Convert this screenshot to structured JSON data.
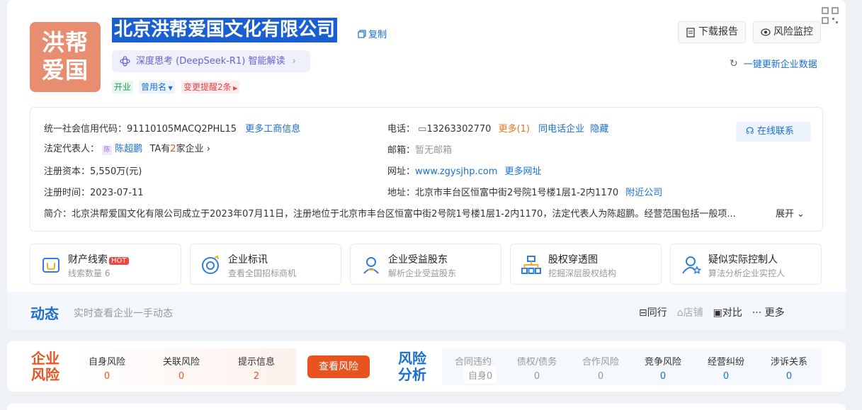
{
  "company": {
    "logo_text_line1": "洪帮",
    "logo_text_line2": "爱国",
    "name": "北京洪帮爱国文化有限公司",
    "copy_label": "复制",
    "ai_label": "深度思考 (DeepSeek-R1) 智能解读",
    "tags": {
      "status": "开业",
      "former_name": "曾用名",
      "change": "变更提醒2条"
    }
  },
  "actions": {
    "download": "下载报告",
    "monitor": "风险监控",
    "refresh": "一键更新企业数据",
    "online": "在线联系"
  },
  "info": {
    "credit_code_label": "统一社会信用代码：",
    "credit_code": "91110105MACQ2PHL15",
    "more_biz": "更多工商信息",
    "legal_label": "法定代表人：",
    "legal_icon": "陈",
    "legal_name": "陈超鹏",
    "legal_ta_prefix": "TA有",
    "legal_ta_count": "2",
    "legal_ta_suffix": "家企业",
    "capital_label": "注册资本：",
    "capital": "5,550万(元)",
    "date_label": "注册时间：",
    "date": "2023-07-11",
    "phone_label": "电话：",
    "phone": "13263302770",
    "phone_more": "更多(1)",
    "same_phone": "同电话企业",
    "hide": "隐藏",
    "email_label": "邮箱：",
    "email": "暂无邮箱",
    "site_label": "网址：",
    "site": "www.zgysjhp.com",
    "more_site": "更多网址",
    "addr_label": "地址：",
    "addr": "北京市丰台区恒富中街2号院1号楼1层1-2内1170",
    "nearby": "附近公司",
    "intro_label": "简介：",
    "intro": "北京洪帮爱国文化有限公司成立于2023年07月11日，注册地位于北京市丰台区恒富中街2号院1号楼1层1-2内1170，法定代表人为陈超鹏。经营范围包括一般项...",
    "expand": "展开"
  },
  "features": [
    {
      "title": "财产线索",
      "badge": "HOT",
      "sub": "线索数量 6"
    },
    {
      "title": "企业标讯",
      "sub": "查看全国招标商机"
    },
    {
      "title": "企业受益股东",
      "sub": "解析企业受益股东"
    },
    {
      "title": "股权穿透图",
      "sub": "挖掘深层股权结构"
    },
    {
      "title": "疑似实际控制人",
      "sub": "算法分析企业实控人"
    }
  ],
  "news": {
    "title": "动态",
    "sub": "实时查看企业一手动态",
    "peer": "同行",
    "shop": "店铺",
    "compare": "对比",
    "more": "更多"
  },
  "risk": {
    "title_line1": "企业",
    "title_line2": "风险",
    "items": [
      {
        "label": "自身风险",
        "count": "0"
      },
      {
        "label": "关联风险",
        "count": "0"
      },
      {
        "label": "提示信息",
        "count": "2"
      }
    ],
    "view_btn": "查看风险",
    "analysis_line1": "风险",
    "analysis_line2": "分析",
    "analysis": [
      {
        "label": "合同违约",
        "count": "0"
      },
      {
        "label": "债权/债务",
        "count": "0"
      },
      {
        "label": "合作风险",
        "count": "0"
      },
      {
        "label": "竞争风险",
        "count": "0"
      },
      {
        "label": "经营纠纷",
        "count": "0"
      },
      {
        "label": "涉诉关系",
        "count": "0"
      }
    ],
    "tooltip": "自身0"
  },
  "colors": {
    "accent": "#1a6fd0",
    "brand_orange": "#e8531f",
    "logo": "#e98d71"
  }
}
